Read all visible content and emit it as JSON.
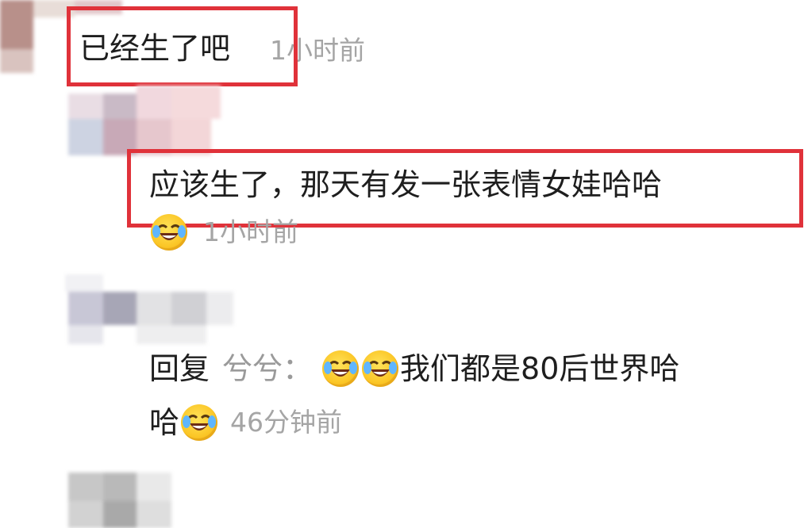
{
  "comments": [
    {
      "text": "已经生了吧",
      "time": "1小时前"
    },
    {
      "text": "应该生了，那天有发一张表情女娃哈哈",
      "time": "1小时前"
    },
    {
      "reply_label": "回复",
      "reply_to": "兮兮：",
      "text_line1": "我们都是80后世界哈",
      "text_line2": "哈",
      "time": "46分钟前"
    }
  ],
  "icons": {
    "laugh_cry": "laugh-cry-emoji"
  },
  "colors": {
    "highlight": "#e0323a",
    "meta": "#a5a5a5",
    "text": "#1e1e1e"
  }
}
